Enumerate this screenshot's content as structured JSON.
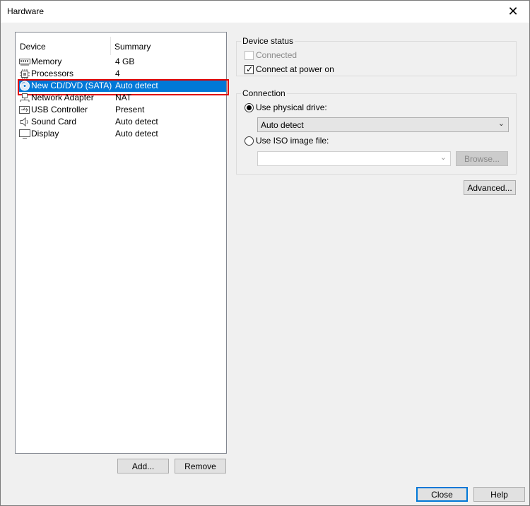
{
  "window": {
    "title": "Hardware",
    "close_glyph": "✕"
  },
  "device_list": {
    "headers": {
      "device": "Device",
      "summary": "Summary"
    },
    "items": [
      {
        "name": "Memory",
        "summary": "4 GB",
        "icon": "memory-icon"
      },
      {
        "name": "Processors",
        "summary": "4",
        "icon": "processor-icon"
      },
      {
        "name": "New CD/DVD (SATA)",
        "summary": "Auto detect",
        "icon": "cd-dvd-icon",
        "selected": true
      },
      {
        "name": "Network Adapter",
        "summary": "NAT",
        "icon": "network-adapter-icon"
      },
      {
        "name": "USB Controller",
        "summary": "Present",
        "icon": "usb-icon"
      },
      {
        "name": "Sound Card",
        "summary": "Auto detect",
        "icon": "speaker-icon"
      },
      {
        "name": "Display",
        "summary": "Auto detect",
        "icon": "monitor-icon"
      }
    ],
    "add_label": "Add...",
    "remove_label": "Remove"
  },
  "device_status": {
    "title": "Device status",
    "connected_label": "Connected",
    "connected_checked": false,
    "connected_enabled": false,
    "connect_power_label": "Connect at power on",
    "connect_power_checked": true
  },
  "connection": {
    "title": "Connection",
    "physical_label": "Use physical drive:",
    "physical_selected": true,
    "physical_value": "Auto detect",
    "iso_label": "Use ISO image file:",
    "iso_value": "",
    "browse_label": "Browse..."
  },
  "advanced_label": "Advanced...",
  "footer": {
    "close_label": "Close",
    "help_label": "Help"
  },
  "colors": {
    "selection": "#0078d7",
    "highlight_border": "#e00000"
  }
}
